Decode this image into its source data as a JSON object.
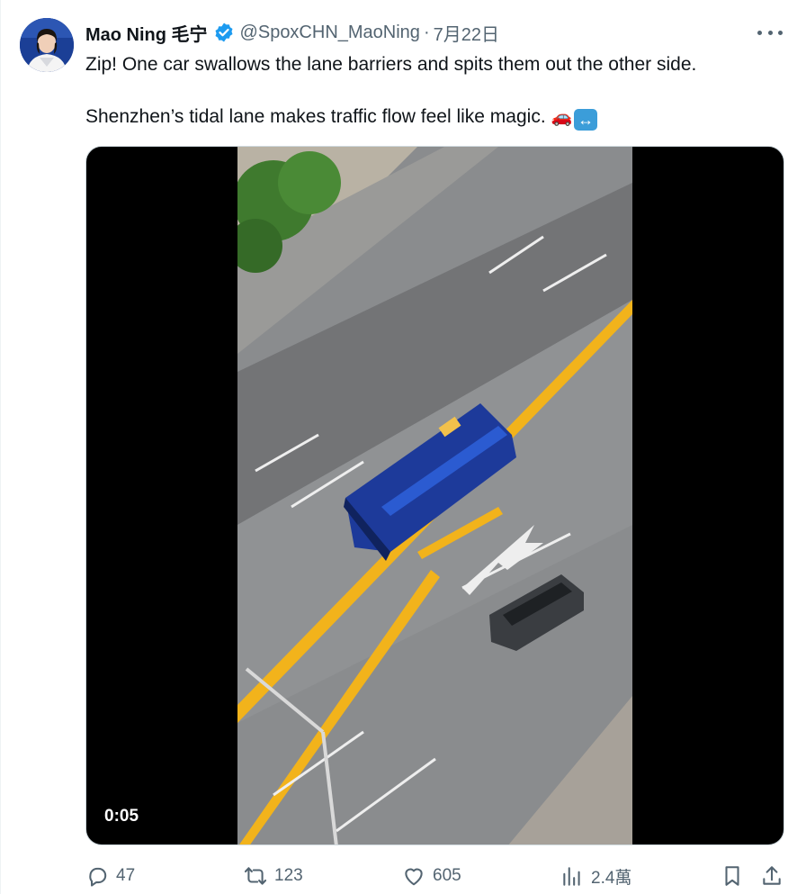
{
  "tweet": {
    "author": {
      "display_name": "Mao Ning 毛宁",
      "handle": "@SpoxCHN_MaoNing",
      "verified": true,
      "avatar": "avatar-photo"
    },
    "separator": "·",
    "date": "7月22日",
    "text_line1": "Zip! One car swallows the lane barriers and spits them out the other side.",
    "text_line2": "Shenzhen’s tidal lane makes traffic flow feel like magic.",
    "emoji_car": "🚗",
    "emoji_arrow": "↔",
    "media": {
      "type": "video",
      "timestamp": "0:05",
      "scene": "aerial-view-of-road-with-bus-moving-lane-barriers"
    },
    "actions": {
      "reply_count": "47",
      "repost_count": "123",
      "like_count": "605",
      "view_count": "2.4萬"
    }
  },
  "colors": {
    "text_primary": "#0f1419",
    "text_secondary": "#536471",
    "verified_blue": "#1d9bf0",
    "barrier_yellow": "#f2b31b"
  },
  "icons": [
    "verified-badge-icon",
    "more-icon",
    "reply-icon",
    "repost-icon",
    "like-icon",
    "views-icon",
    "bookmark-icon",
    "share-icon"
  ]
}
